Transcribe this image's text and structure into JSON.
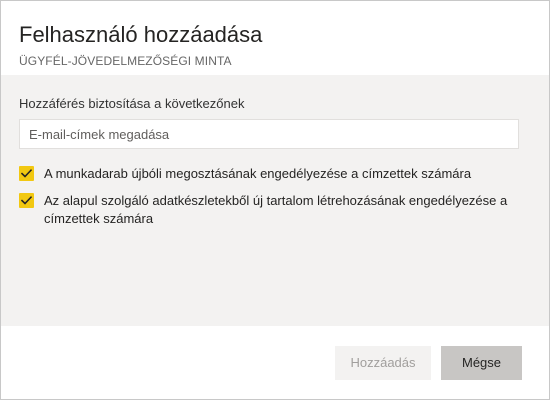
{
  "dialog": {
    "title": "Felhasználó hozzáadása",
    "subtitle": "ÜGYFÉL-JÖVEDELMEZŐSÉGI MINTA"
  },
  "form": {
    "access_label": "Hozzáférés biztosítása a következőnek",
    "email_placeholder": "E-mail-címek megadása",
    "email_value": "",
    "options": [
      {
        "label": "A munkadarab újbóli megosztásának engedélyezése a címzettek számára",
        "checked": true
      },
      {
        "label": "Az alapul szolgáló adatkészletekből új tartalom létrehozásának engedélyezése a címzettek számára",
        "checked": true
      }
    ]
  },
  "footer": {
    "add_label": "Hozzáadás",
    "add_enabled": false,
    "cancel_label": "Mégse"
  },
  "colors": {
    "checkbox_accent": "#f2c811",
    "body_background": "#f3f2f1",
    "cancel_button": "#c8c6c4",
    "disabled_text": "#a19f9d"
  },
  "icons": {
    "checkbox_mark": "checkmark-icon"
  }
}
